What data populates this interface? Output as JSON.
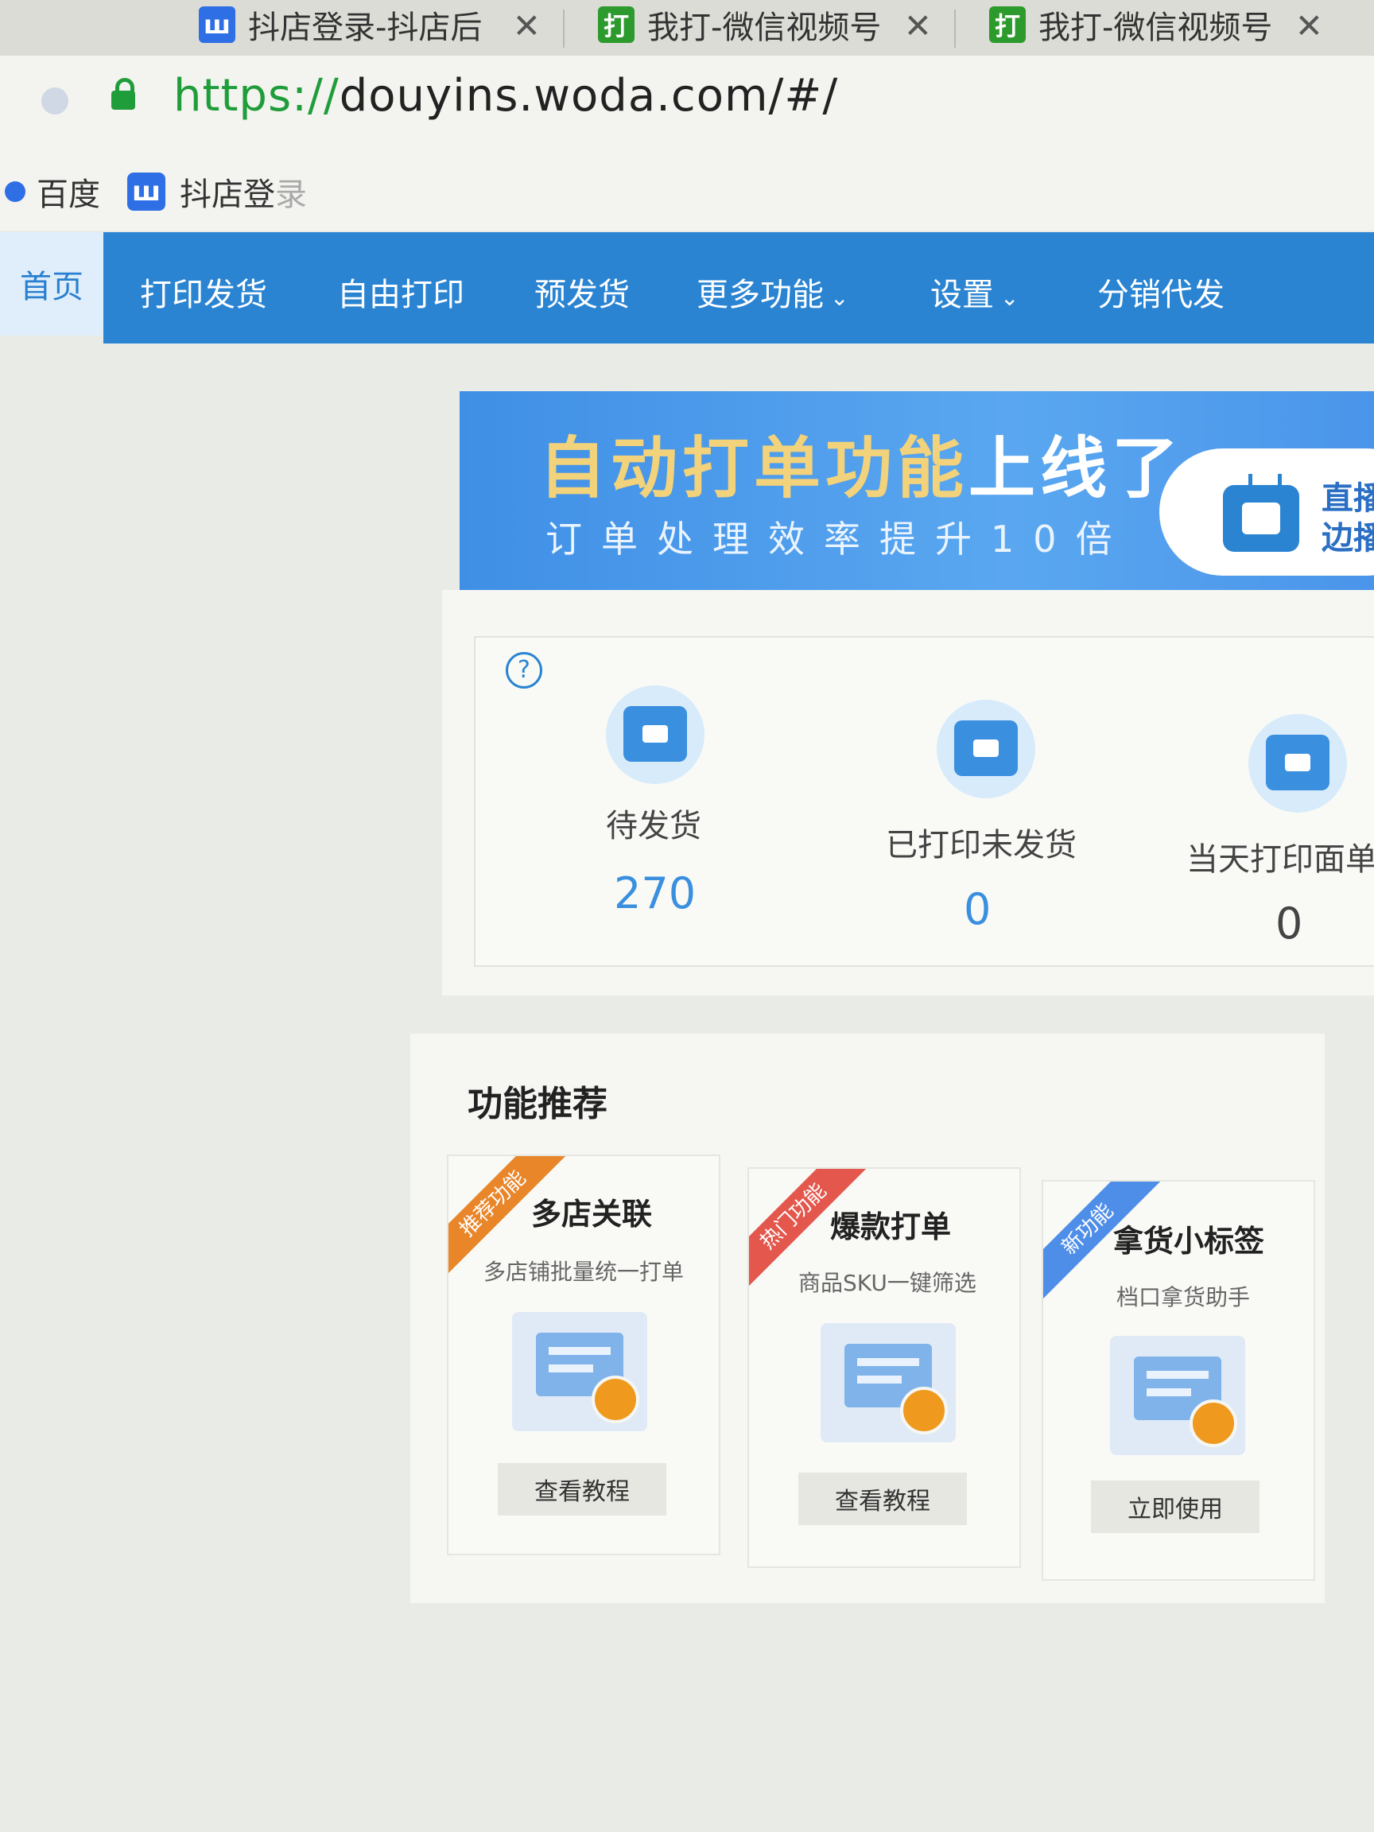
{
  "browser": {
    "tabs": [
      {
        "title": "抖店登录-抖店后",
        "icon": "ш"
      },
      {
        "title": "我打-微信视频号",
        "icon": "打"
      },
      {
        "title": "我打-微信视频号",
        "icon": "打"
      }
    ],
    "close_symbol": "✕",
    "url_scheme": "https://",
    "url_rest": "douyins.woda.com/#/",
    "bookmarks": [
      {
        "label": "百度"
      },
      {
        "label": "抖店登",
        "label_faded": "录",
        "icon": "ш"
      }
    ]
  },
  "nav": {
    "items": [
      "首页",
      "打印发货",
      "自由打印",
      "预发货",
      "更多功能",
      "设置",
      "分销代发"
    ],
    "chevron": "⌄"
  },
  "banner": {
    "title_yellow": "自动打单功能",
    "title_white": "上线了",
    "subtitle": "订单处理效率提升10倍",
    "side_line1": "直播",
    "side_line2": "边播"
  },
  "stats": {
    "help": "?",
    "items": [
      {
        "label": "待发货",
        "value": "270"
      },
      {
        "label": "已打印未发货",
        "value": "0"
      },
      {
        "label": "当天打印面单数",
        "value": "0"
      }
    ]
  },
  "features": {
    "title": "功能推荐",
    "items": [
      {
        "ribbon": "推荐功能",
        "name": "多店关联",
        "desc": "多店铺批量统一打单",
        "button": "查看教程"
      },
      {
        "ribbon": "热门功能",
        "name": "爆款打单",
        "desc": "商品SKU一键筛选",
        "button": "查看教程"
      },
      {
        "ribbon": "新功能",
        "name": "拿货小标签",
        "desc": "档口拿货助手",
        "button": "立即使用"
      }
    ]
  },
  "colors": {
    "nav_blue": "#2a84d2",
    "banner_yellow": "#f2d27a",
    "ribbon_orange": "#e9862a",
    "ribbon_red": "#e3574d",
    "ribbon_blue": "#4f8ee8",
    "lock_green": "#1f9d3a"
  }
}
